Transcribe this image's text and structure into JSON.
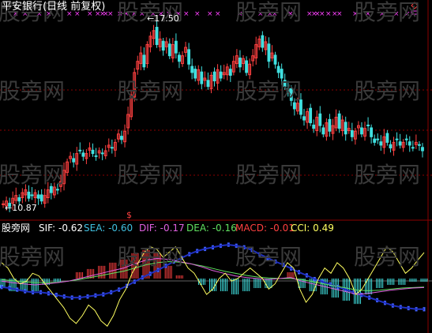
{
  "header": {
    "title": "平安银行(日线 前复权)",
    "high_label": "17.50",
    "low_label": "10.87",
    "indicator_name": "股旁网"
  },
  "indicators": [
    {
      "name": "SIF",
      "value": "-0.62",
      "color": "#ffffff"
    },
    {
      "name": "SEA",
      "value": "-0.60",
      "color": "#40c0e0"
    },
    {
      "name": "DIF",
      "value": "-0.17",
      "color": "#e060e0"
    },
    {
      "name": "DEA",
      "value": "-0.16",
      "color": "#60e060"
    },
    {
      "name": "MACD",
      "value": "-0.01",
      "color": "#ff4040"
    },
    {
      "name": "CCI",
      "value": "0.49",
      "color": "#ffff60"
    }
  ],
  "watermarks": [
    "股旁网",
    "股旁网",
    "股旁网",
    "股旁网",
    "股旁网",
    "股旁网",
    "股旁网",
    "股旁网",
    "股旁网",
    "股旁网",
    "股旁网",
    "股旁网",
    "股旁网",
    "股旁网",
    "股旁网",
    "股旁网"
  ],
  "colors": {
    "up": "#ff4040",
    "down": "#40e0e0",
    "grid": "#8b0000",
    "marker": "#ff40ff",
    "dif": "#e060e0",
    "dea": "#60e060",
    "cci": "#ffff60",
    "sea": "#4060ff"
  },
  "chart_data": {
    "type": "candlestick",
    "price_range": [
      10.6,
      18.0
    ],
    "high": 17.5,
    "low": 10.87,
    "closes": [
      11.1,
      11.2,
      11.0,
      11.3,
      11.4,
      11.2,
      11.5,
      11.6,
      11.3,
      11.4,
      11.5,
      11.3,
      11.2,
      11.4,
      11.6,
      11.5,
      11.7,
      11.6,
      11.9,
      12.3,
      12.6,
      12.8,
      12.6,
      12.9,
      13.0,
      12.8,
      12.9,
      13.1,
      12.9,
      12.8,
      13.0,
      12.9,
      13.0,
      13.2,
      13.1,
      13.3,
      13.6,
      13.4,
      13.7,
      14.3,
      15.0,
      15.8,
      16.2,
      16.5,
      16.0,
      16.8,
      17.1,
      17.3,
      16.8,
      17.0,
      16.6,
      16.9,
      16.4,
      16.8,
      16.5,
      16.2,
      16.4,
      16.7,
      16.1,
      15.8,
      15.6,
      15.9,
      15.4,
      15.6,
      15.3,
      15.7,
      15.5,
      15.9,
      15.6,
      15.8,
      16.0,
      15.7,
      16.2,
      16.4,
      16.0,
      16.3,
      15.8,
      16.1,
      16.4,
      16.8,
      17.0,
      16.7,
      16.9,
      16.2,
      16.5,
      16.1,
      15.8,
      15.6,
      15.3,
      15.1,
      14.8,
      14.5,
      14.7,
      14.3,
      14.1,
      14.4,
      14.0,
      13.8,
      14.2,
      13.9,
      13.6,
      14.0,
      13.7,
      13.9,
      14.2,
      13.8,
      14.1,
      13.6,
      13.8,
      13.5,
      13.7,
      13.9,
      13.6,
      13.8,
      13.9,
      13.5,
      13.3,
      13.4,
      13.2,
      13.5,
      13.3,
      13.1,
      13.3,
      13.4,
      13.2,
      13.3,
      13.4,
      13.2,
      13.1,
      13.3,
      13.2,
      13.0
    ],
    "indicator_range": [
      -1.0,
      0.85
    ],
    "sif": [
      -0.2,
      -0.22,
      -0.25,
      -0.28,
      -0.3,
      -0.3,
      -0.32,
      -0.35,
      -0.38,
      -0.4,
      -0.4,
      -0.38,
      -0.36,
      -0.34,
      -0.3,
      -0.25,
      -0.18,
      -0.1,
      -0.02,
      0.05,
      0.12,
      0.2,
      0.28,
      0.35,
      0.42,
      0.48,
      0.52,
      0.55,
      0.58,
      0.6,
      0.58,
      0.55,
      0.5,
      0.42,
      0.35,
      0.28,
      0.22,
      0.15,
      0.08,
      0.02,
      -0.05,
      -0.1,
      -0.15,
      -0.2,
      -0.25,
      -0.3,
      -0.35,
      -0.4,
      -0.45,
      -0.5,
      -0.55,
      -0.58,
      -0.6,
      -0.62,
      -0.62
    ],
    "dif": [
      -0.05,
      -0.08,
      -0.1,
      -0.12,
      -0.1,
      -0.08,
      -0.05,
      0.0,
      0.05,
      0.1,
      0.15,
      0.2,
      0.28,
      0.35,
      0.38,
      0.36,
      0.32,
      0.28,
      0.22,
      0.15,
      0.1,
      0.05,
      0.02,
      0.0,
      -0.02,
      0.0,
      0.02,
      -0.05,
      -0.1,
      -0.15,
      -0.2,
      -0.25,
      -0.3,
      -0.28,
      -0.25,
      -0.22,
      -0.2,
      -0.18,
      -0.17
    ],
    "dea": [
      -0.02,
      -0.04,
      -0.06,
      -0.08,
      -0.08,
      -0.07,
      -0.05,
      -0.02,
      0.02,
      0.06,
      0.1,
      0.14,
      0.2,
      0.26,
      0.3,
      0.32,
      0.31,
      0.28,
      0.24,
      0.19,
      0.14,
      0.1,
      0.06,
      0.03,
      0.01,
      0.0,
      0.0,
      -0.02,
      -0.06,
      -0.1,
      -0.14,
      -0.18,
      -0.22,
      -0.23,
      -0.22,
      -0.2,
      -0.18,
      -0.17,
      -0.16
    ],
    "cci": [
      0.3,
      0.2,
      0.0,
      -0.1,
      -0.05,
      0.1,
      0.05,
      -0.1,
      -0.25,
      -0.4,
      -0.55,
      -0.75,
      -0.85,
      -0.7,
      -0.5,
      -0.6,
      -0.8,
      -0.9,
      -0.7,
      -0.4,
      -0.2,
      0.1,
      0.3,
      0.5,
      0.6,
      0.55,
      0.4,
      0.5,
      0.6,
      0.4,
      0.2,
      0.1,
      -0.1,
      -0.3,
      -0.2,
      0.0,
      0.1,
      -0.05,
      0.0,
      0.1,
      0.2,
      0.1,
      0.0,
      -0.2,
      -0.1,
      0.1,
      0.3,
      0.2,
      -0.2,
      -0.45,
      -0.3,
      0.0,
      0.2,
      0.1,
      0.3,
      0.2,
      0.0,
      -0.3,
      -0.2,
      0.0,
      0.2,
      0.4,
      0.6,
      0.5,
      0.3,
      0.1,
      0.2,
      0.35,
      0.49
    ]
  }
}
